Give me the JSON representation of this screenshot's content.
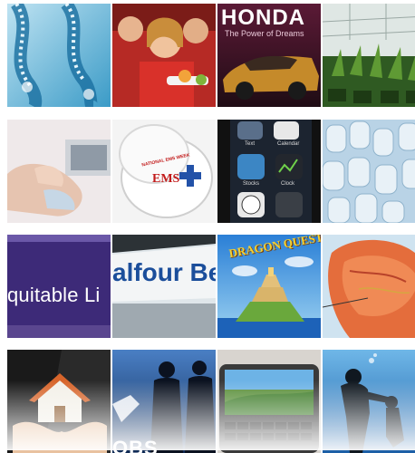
{
  "grid": {
    "tiles": [
      {
        "name": "dna-thumbnail",
        "alt": "DNA strands"
      },
      {
        "name": "schoolchildren-thumbnail",
        "alt": "Schoolchildren at lunch"
      },
      {
        "name": "honda-thumbnail",
        "alt": "Honda car advert",
        "brand": "HONDA",
        "tagline": "The Power of Dreams"
      },
      {
        "name": "greenhouse-thumbnail",
        "alt": "Greenhouse plants"
      },
      {
        "name": "ultrasound-thumbnail",
        "alt": "Ultrasound scan"
      },
      {
        "name": "ems-badge-thumbnail",
        "alt": "EMS week badge",
        "badge_text": "EMS",
        "badge_top": "NATIONAL EMS WEEK"
      },
      {
        "name": "smartphone-apps-thumbnail",
        "alt": "Smartphone app icons",
        "app_labels": [
          "Text",
          "Calendar",
          "Stocks",
          "Clock"
        ]
      },
      {
        "name": "bottles-thumbnail",
        "alt": "Bottles on production line"
      },
      {
        "name": "equitable-life-thumbnail",
        "alt": "Equitable Life sign",
        "brand": "quitable Li"
      },
      {
        "name": "balfour-beatty-thumbnail",
        "alt": "Balfour Beatty sign",
        "brand": "alfour Beatt"
      },
      {
        "name": "game-thumbnail",
        "alt": "Dragon Quest game art",
        "logo": "DRAGON QUEST"
      },
      {
        "name": "anatomy-thumbnail",
        "alt": "Anatomical illustration"
      },
      {
        "name": "house-in-hands-thumbnail",
        "alt": "House held in hands"
      },
      {
        "name": "silhouettes-jobs-thumbnail",
        "alt": "Silhouettes jobs graphic",
        "caption": "OBS"
      },
      {
        "name": "phone-keyboard-thumbnail",
        "alt": "Slide-out phone keyboard"
      },
      {
        "name": "divers-thumbnail",
        "alt": "Underwater divers"
      }
    ]
  },
  "colors": {
    "background": "#ffffff"
  }
}
